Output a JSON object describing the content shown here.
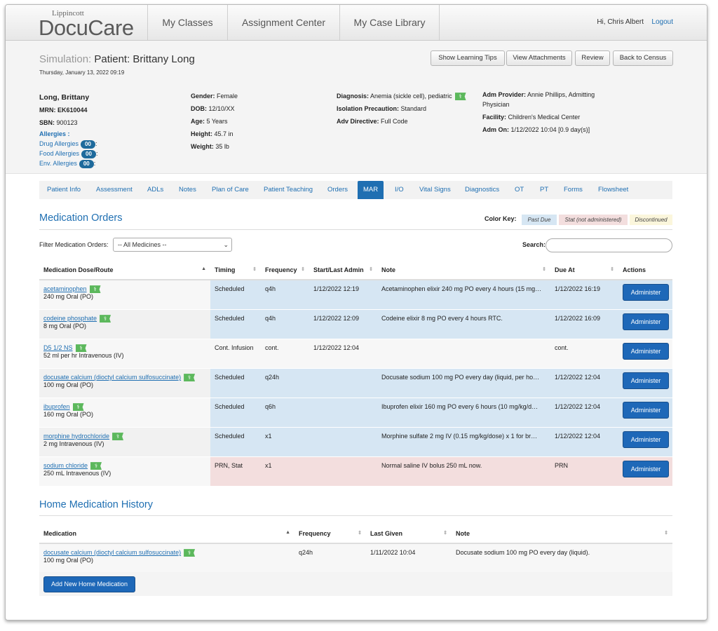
{
  "brand": {
    "publisher": "Lippincott",
    "product": "DocuCare"
  },
  "nav": {
    "tabs": [
      "My Classes",
      "Assignment Center",
      "My Case Library"
    ],
    "user": "Hi, Chris Albert",
    "logout": "Logout"
  },
  "header": {
    "sim_label": "Simulation:",
    "patient_title": "Patient: Brittany Long",
    "datetime": "Thursday, January 13, 2022 09:19",
    "buttons": [
      "Show Learning Tips",
      "View Attachments",
      "Review",
      "Back to Census"
    ]
  },
  "patient": {
    "name": "Long, Brittany",
    "mrn_label": "MRN:",
    "mrn": "EK610044",
    "sbn_label": "SBN:",
    "sbn": "900123",
    "allergies_label": "Allergies :",
    "drug_allergies": "Drug Allergies",
    "food_allergies": "Food Allergies",
    "env_allergies": "Env. Allergies",
    "allergy_count": "00",
    "gender_label": "Gender:",
    "gender": "Female",
    "dob_label": "DOB:",
    "dob": "12/10/XX",
    "age_label": "Age:",
    "age": "5 Years",
    "height_label": "Height:",
    "height": "45.7 in",
    "weight_label": "Weight:",
    "weight": "35 lb",
    "diagnosis_label": "Diagnosis:",
    "diagnosis": "Anemia (sickle cell), pediatric",
    "isolation_label": "Isolation Precaution:",
    "isolation": "Standard",
    "directive_label": "Adv Directive:",
    "directive": "Full Code",
    "provider_label": "Adm Provider:",
    "provider": "Annie Phillips, Admitting Physician",
    "facility_label": "Facility:",
    "facility": "Children's Medical Center",
    "admon_label": "Adm On:",
    "admon": "1/12/2022 10:04 [0.9 day(s)]"
  },
  "subnav": {
    "tabs": [
      "Patient Info",
      "Assessment",
      "ADLs",
      "Notes",
      "Plan of Care",
      "Patient Teaching",
      "Orders",
      "MAR",
      "I/O",
      "Vital Signs",
      "Diagnostics",
      "OT",
      "PT",
      "Forms",
      "Flowsheet"
    ],
    "active": "MAR"
  },
  "orders": {
    "title": "Medication Orders",
    "color_key_label": "Color Key:",
    "color_keys": [
      {
        "label": "Past Due",
        "color": "#d6e6f3"
      },
      {
        "label": "Stat (not administered)",
        "color": "#f3dede"
      },
      {
        "label": "Discontinued",
        "color": "#fbf6dc"
      }
    ],
    "filter_label": "Filter Medication Orders:",
    "filter_value": "-- All Medicines --",
    "search_label": "Search:",
    "columns": [
      "Medication Dose/Route",
      "Timing",
      "Frequency",
      "Start/Last Admin",
      "Note",
      "Due At",
      "Actions"
    ],
    "action_label": "Administer",
    "rows": [
      {
        "name": "acetaminophen",
        "dose": "240 mg Oral (PO)",
        "timing": "Scheduled",
        "freq": "q4h",
        "start": "1/12/2022 12:19",
        "note": "Acetaminophen elixir 240 mg PO every 4 hours (15 mg…",
        "due": "1/12/2022 16:19",
        "status": "past"
      },
      {
        "name": "codeine phosphate",
        "dose": "8 mg Oral (PO)",
        "timing": "Scheduled",
        "freq": "q4h",
        "start": "1/12/2022 12:09",
        "note": "Codeine elixir 8 mg PO every 4 hours RTC.",
        "due": "1/12/2022 16:09",
        "status": "past"
      },
      {
        "name": "D5 1/2 NS",
        "dose": "52 ml per hr Intravenous (IV)",
        "timing": "Cont. Infusion",
        "freq": "cont.",
        "start": "1/12/2022 12:04",
        "note": "",
        "due": "cont.",
        "status": "none"
      },
      {
        "name": "docusate calcium (dioctyl calcium sulfosuccinate)",
        "dose": "100 mg Oral (PO)",
        "timing": "Scheduled",
        "freq": "q24h",
        "start": "",
        "note": "Docusate sodium 100 mg PO every day (liquid, per ho…",
        "due": "1/12/2022 12:04",
        "status": "past"
      },
      {
        "name": "ibuprofen",
        "dose": "160 mg Oral (PO)",
        "timing": "Scheduled",
        "freq": "q6h",
        "start": "",
        "note": "Ibuprofen elixir 160 mg PO every 6 hours (10 mg/kg/d…",
        "due": "1/12/2022 12:04",
        "status": "past"
      },
      {
        "name": "morphine hydrochloride",
        "dose": "2 mg Intravenous (IV)",
        "timing": "Scheduled",
        "freq": "x1",
        "start": "",
        "note": "Morphine sulfate 2 mg IV (0.15 mg/kg/dose) x 1 for br…",
        "due": "1/12/2022 12:04",
        "status": "past"
      },
      {
        "name": "sodium chloride",
        "dose": "250 mL Intravenous (IV)",
        "timing": "PRN, Stat",
        "freq": "x1",
        "start": "",
        "note": "Normal saline IV bolus 250 mL now.",
        "due": "PRN",
        "status": "stat"
      }
    ]
  },
  "home": {
    "title": "Home Medication History",
    "columns": [
      "Medication",
      "Frequency",
      "Last Given",
      "Note"
    ],
    "rows": [
      {
        "name": "docusate calcium (dioctyl calcium sulfosuccinate)",
        "dose": "100 mg Oral (PO)",
        "freq": "q24h",
        "last": "1/11/2022 10:04",
        "note": "Docusate sodium 100 mg PO every day (liquid)."
      }
    ],
    "add_button": "Add New Home Medication"
  }
}
